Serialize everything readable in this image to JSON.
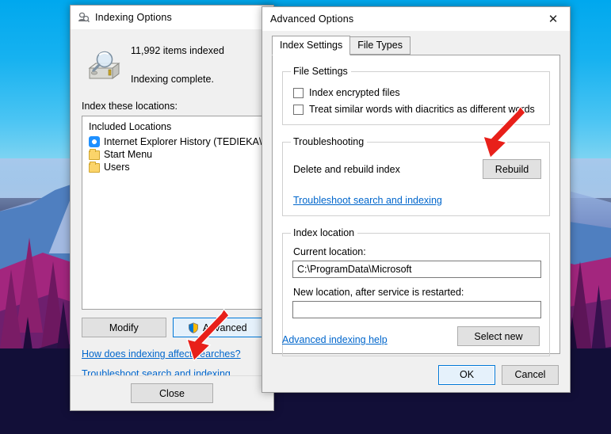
{
  "desktop": {
    "wallpaper": "mountain-forest-sunset",
    "sky_color": "#00a8ee",
    "ground_color": "#120f38"
  },
  "indexing_options": {
    "title": "Indexing Options",
    "title_icon": "indexing-options-icon",
    "status_icon": "drive-magnifier-icon",
    "items_indexed": "11,992 items indexed",
    "status": "Indexing complete.",
    "locations_label": "Index these locations:",
    "list_header": "Included Locations",
    "locations": [
      {
        "icon": "internet-explorer-icon",
        "label": "Internet Explorer History (TEDIEKA\\tedi…"
      },
      {
        "icon": "folder-icon",
        "label": "Start Menu"
      },
      {
        "icon": "folder-icon",
        "label": "Users"
      }
    ],
    "modify_label": "Modify",
    "advanced_label": "Advanced",
    "advanced_icon": "uac-shield-icon",
    "links": [
      "How does indexing affect searches?",
      "Troubleshoot search and indexing"
    ],
    "close_label": "Close"
  },
  "advanced_options": {
    "title": "Advanced Options",
    "close_icon": "close-icon",
    "tabs": [
      {
        "label": "Index Settings",
        "active": true
      },
      {
        "label": "File Types",
        "active": false
      }
    ],
    "file_settings": {
      "legend": "File Settings",
      "checkboxes": [
        {
          "label": "Index encrypted files",
          "checked": false
        },
        {
          "label": "Treat similar words with diacritics as different words",
          "checked": false
        }
      ]
    },
    "troubleshooting": {
      "legend": "Troubleshooting",
      "rebuild_label": "Delete and rebuild index",
      "rebuild_button": "Rebuild",
      "link": "Troubleshoot search and indexing"
    },
    "index_location": {
      "legend": "Index location",
      "current_label": "Current location:",
      "current_value": "C:\\ProgramData\\Microsoft",
      "new_label": "New location, after service is restarted:",
      "new_value": "",
      "select_new_label": "Select new"
    },
    "help_link": "Advanced indexing help",
    "ok_label": "OK",
    "cancel_label": "Cancel"
  },
  "annotations": {
    "arrow_color": "#e8201a",
    "arrows": [
      {
        "name": "arrow-to-rebuild",
        "points_at": "Rebuild"
      },
      {
        "name": "arrow-to-advanced",
        "points_at": "Advanced"
      }
    ]
  }
}
